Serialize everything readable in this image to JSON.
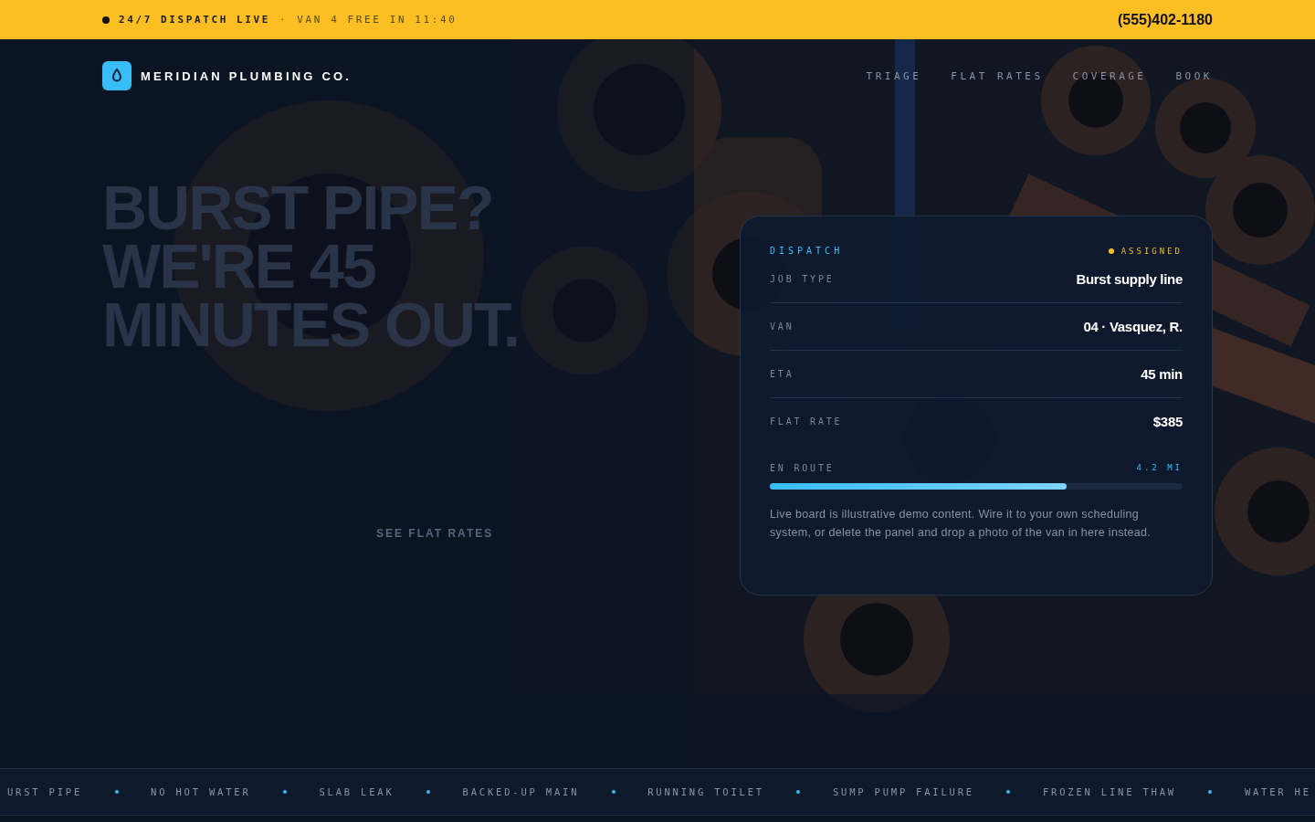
{
  "top_bar": {
    "status": "24/7 DISPATCH LIVE",
    "separator": "·",
    "availability": "VAN 4 FREE IN 11:40",
    "phone": "(555)402-1180"
  },
  "nav": {
    "brand": "MERIDIAN PLUMBING CO.",
    "links": [
      "TRIAGE",
      "FLAT RATES",
      "COVERAGE",
      "BOOK"
    ]
  },
  "hero": {
    "headline": [
      "BURST PIPE?",
      "WE'RE 45",
      "MINUTES OUT."
    ],
    "secondary_link": "SEE FLAT RATES",
    "background": {
      "kind": "picture"
    }
  },
  "dispatch_card": {
    "title": "DISPATCH",
    "status": {
      "label": "ASSIGNED",
      "color": "#fbbf24"
    },
    "rows": [
      {
        "label": "JOB TYPE",
        "value": "Burst supply line"
      },
      {
        "label": "VAN",
        "value": "04 · Vasquez, R."
      },
      {
        "label": "ETA",
        "value": "45 min"
      },
      {
        "label": "FLAT RATE",
        "value": "$385"
      }
    ],
    "progress": {
      "label": "EN ROUTE",
      "reading": "4.2 MI",
      "level": 0.72
    },
    "note": "Live board is illustrative demo content. Wire it to your own scheduling system, or delete the panel and drop a photo of the van in here instead."
  },
  "ticker": {
    "items": [
      "URST PIPE",
      "NO HOT WATER",
      "SLAB LEAK",
      "BACKED-UP MAIN",
      "RUNNING TOILET",
      "SUMP PUMP FAILURE",
      "FROZEN LINE THAW",
      "WATER HE"
    ]
  }
}
